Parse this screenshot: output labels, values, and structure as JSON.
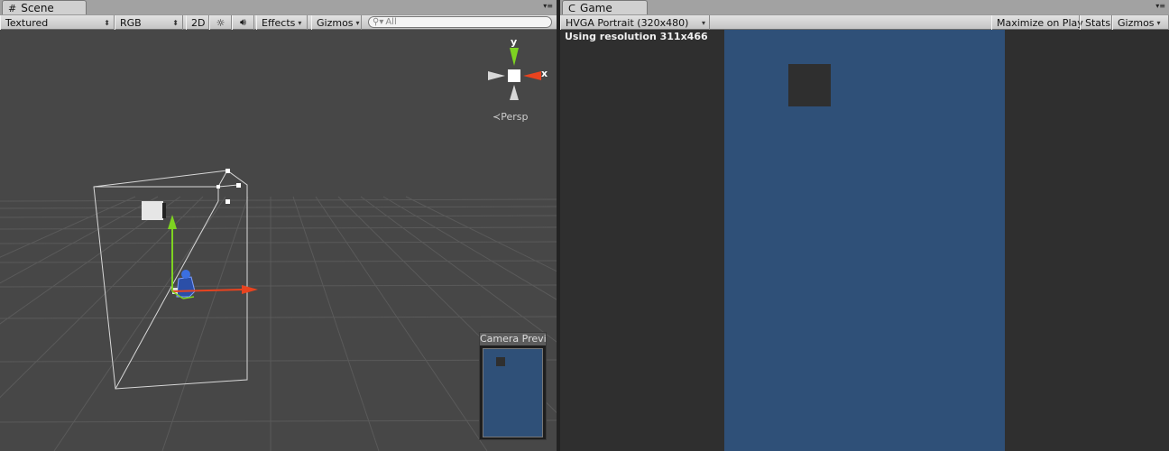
{
  "scene": {
    "tab_label": "Scene",
    "tab_icon": "grid-icon",
    "toolbar": {
      "draw_mode": "Textured",
      "render_mode": "RGB",
      "mode_2d": "2D",
      "effects": "Effects",
      "gizmos": "Gizmos",
      "search_placeholder": "All"
    },
    "gizmo_labels": {
      "y": "y",
      "x": "x"
    },
    "persp_label": "Persp",
    "camera_preview_title": "Camera Preview"
  },
  "game": {
    "tab_label": "Game",
    "tab_icon": "pacman-icon",
    "toolbar": {
      "aspect": "HVGA Portrait (320x480)",
      "maximize": "Maximize on Play",
      "stats": "Stats",
      "gizmos": "Gizmos"
    },
    "resolution_text": "Using resolution 311x466"
  },
  "colors": {
    "camera_background": "#2f5078",
    "sprite": "#2f2f2f",
    "scene_background": "#474747",
    "axis_x": "#e8431f",
    "axis_y": "#7ed321",
    "axis_z": "#3b6fe0"
  }
}
